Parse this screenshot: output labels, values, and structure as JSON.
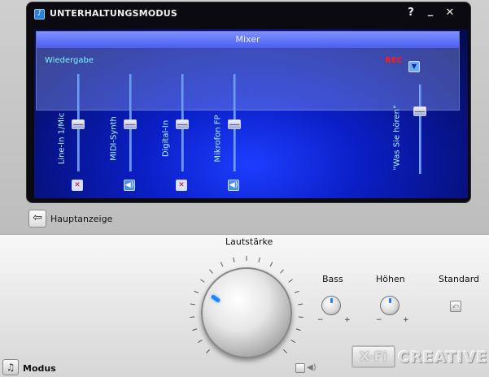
{
  "window": {
    "title": "UNTERHALTUNGSMODUS",
    "help": "?",
    "minimize": "_",
    "close": "✕"
  },
  "mixer": {
    "header": "Mixer",
    "playback_label": "Wiedergabe",
    "rec_label": "REC",
    "rec_dropdown_icon": "▼",
    "channels": [
      {
        "label": "Line-In 1/Mic",
        "level": 0.52,
        "muted": true
      },
      {
        "label": "MIDI-Synth",
        "level": 0.52,
        "muted": false
      },
      {
        "label": "Digital-In",
        "level": 0.52,
        "muted": true
      },
      {
        "label": "Mikrofon FP",
        "level": 0.52,
        "muted": false
      }
    ],
    "record_channel": {
      "label": "\"Was Sie hören\"",
      "level": 0.28
    }
  },
  "nav": {
    "back_label": "Hauptanzeige",
    "back_icon": "back-arrow-icon"
  },
  "controls": {
    "volume_label": "Lautstärke",
    "volume_level": 0.0,
    "bass_label": "Bass",
    "treble_label": "Höhen",
    "standard_label": "Standard",
    "minus": "−",
    "plus": "+"
  },
  "footer": {
    "mode_label": "Modus",
    "xfi_logo": "X-Fi",
    "creative_logo": "CREATIVE"
  },
  "colors": {
    "accent": "#1e86ff",
    "rec_red": "#ff1a1a",
    "mixer_blue": "#0b1fc7"
  }
}
